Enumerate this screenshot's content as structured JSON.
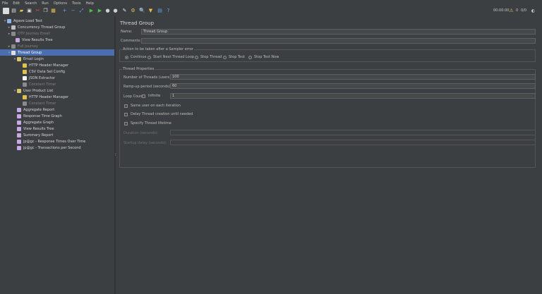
{
  "menu": [
    "File",
    "Edit",
    "Search",
    "Run",
    "Options",
    "Tools",
    "Help"
  ],
  "toolbar": {
    "timer": "00:00:00",
    "warnings": "0",
    "threads": "0/0"
  },
  "tree": [
    {
      "label": "Agave Load Test",
      "icon": "flask-icon",
      "color": "#8fb4e8",
      "toggle": "▾",
      "disabled": false
    },
    {
      "label": "Concurrency Thread Group",
      "icon": "gear-icon",
      "color": "#bfbfbf",
      "toggle": "▸",
      "disabled": false
    },
    {
      "label": "OTP Journey Email",
      "icon": "gear-icon",
      "color": "#8a8a8a",
      "toggle": "▸",
      "disabled": true
    },
    {
      "label": "View Results Tree",
      "icon": "chart-icon",
      "color": "#c9a8e8",
      "toggle": "",
      "disabled": false
    },
    {
      "label": "Full Journey",
      "icon": "gear-icon",
      "color": "#8a8a8a",
      "toggle": "▸",
      "disabled": true
    },
    {
      "label": "Thread Group",
      "icon": "gear-icon",
      "color": "#e0e0e0",
      "toggle": "▾",
      "disabled": false
    },
    {
      "label": "Email Login",
      "icon": "pencil-icon",
      "color": "#d9c56a",
      "toggle": "▾",
      "disabled": false
    },
    {
      "label": "HTTP Header Manager",
      "icon": "wrench-icon",
      "color": "#e0c050",
      "toggle": "",
      "disabled": false
    },
    {
      "label": "CSV Data Set Config",
      "icon": "wrench-icon",
      "color": "#e0c050",
      "toggle": "",
      "disabled": false
    },
    {
      "label": "JSON Extractor",
      "icon": "doc-icon",
      "color": "#f2f2f2",
      "toggle": "",
      "disabled": false
    },
    {
      "label": "Constant Timer",
      "icon": "clock-icon",
      "color": "#8a8a8a",
      "toggle": "",
      "disabled": true
    },
    {
      "label": "User Product List",
      "icon": "pencil-icon",
      "color": "#d9c56a",
      "toggle": "▾",
      "disabled": false
    },
    {
      "label": "HTTP Header Manager",
      "icon": "wrench-icon",
      "color": "#e0c050",
      "toggle": "",
      "disabled": false
    },
    {
      "label": "Constant Timer",
      "icon": "clock-icon",
      "color": "#8a8a8a",
      "toggle": "",
      "disabled": true
    },
    {
      "label": "Aggregate Report",
      "icon": "chart-icon",
      "color": "#c9a8e8",
      "toggle": "",
      "disabled": false
    },
    {
      "label": "Response Time Graph",
      "icon": "chart-icon",
      "color": "#c9a8e8",
      "toggle": "",
      "disabled": false
    },
    {
      "label": "Aggregate Graph",
      "icon": "chart-icon",
      "color": "#c9a8e8",
      "toggle": "",
      "disabled": false
    },
    {
      "label": "View Results Tree",
      "icon": "chart-icon",
      "color": "#c9a8e8",
      "toggle": "",
      "disabled": false
    },
    {
      "label": "Summary Report",
      "icon": "chart-icon",
      "color": "#c9a8e8",
      "toggle": "",
      "disabled": false
    },
    {
      "label": "jp@gc - Response Times Over Time",
      "icon": "chart-icon",
      "color": "#c9a8e8",
      "toggle": "",
      "disabled": false
    },
    {
      "label": "jp@gc - Transactions per Second",
      "icon": "chart-icon",
      "color": "#c9a8e8",
      "toggle": "",
      "disabled": false
    }
  ],
  "selected_index": 5,
  "panel": {
    "title": "Thread Group",
    "name_label": "Name:",
    "name_value": "Thread Group",
    "comments_label": "Comments:",
    "comments_value": "",
    "action_legend": "Action to be taken after a Sampler error",
    "actions": [
      "Continue",
      "Start Next Thread Loop",
      "Stop Thread",
      "Stop Test",
      "Stop Test Now"
    ],
    "action_selected": 0,
    "props_legend": "Thread Properties",
    "threads_label": "Number of Threads (users):",
    "threads_value": "100",
    "rampup_label": "Ramp-up period (seconds):",
    "rampup_value": "60",
    "loop_label": "Loop Count:",
    "infinite_label": "Infinite",
    "loop_value": "1",
    "same_user_label": "Same user on each iteration",
    "delay_label": "Delay Thread creation until needed",
    "lifetime_label": "Specify Thread lifetime",
    "duration_label": "Duration (seconds):",
    "startup_label": "Startup delay (seconds):"
  },
  "colors": {
    "background": "#3c3f41",
    "selection": "#4b6eaf",
    "field": "#45494a"
  }
}
